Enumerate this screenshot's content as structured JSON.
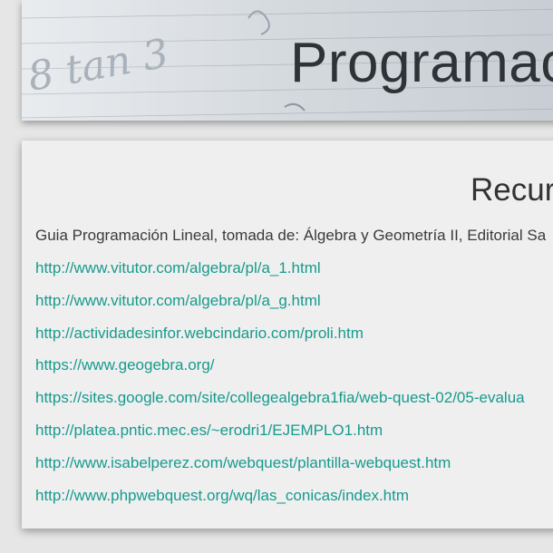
{
  "hero": {
    "title": "Programac",
    "scribble_text": "8 tan 3"
  },
  "resources": {
    "title": "Recur",
    "description": "Guia Programación Lineal, tomada de: Álgebra y Geometría II, Editorial Sa",
    "links": [
      "http://www.vitutor.com/algebra/pl/a_1.html",
      "http://www.vitutor.com/algebra/pl/a_g.html",
      "http://actividadesinfor.webcindario.com/proli.htm",
      "https://www.geogebra.org/",
      "https://sites.google.com/site/collegealgebra1fia/web-quest-02/05-evalua",
      "http://platea.pntic.mec.es/~erodri1/EJEMPLO1.htm",
      "http://www.isabelperez.com/webquest/plantilla-webquest.htm",
      "http://www.phpwebquest.org/wq/las_conicas/index.htm"
    ]
  },
  "colors": {
    "link": "#169b8c",
    "page_bg": "#e6e6e6",
    "card_bg": "#efefef"
  }
}
